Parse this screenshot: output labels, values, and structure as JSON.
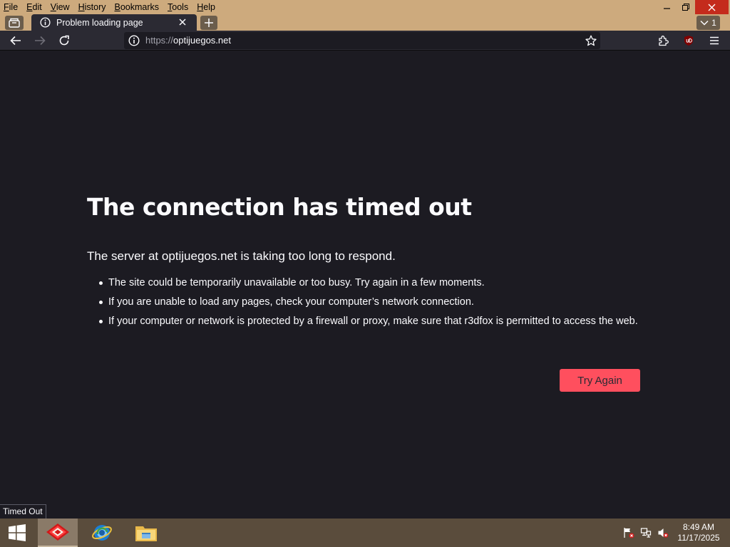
{
  "menu": [
    "File",
    "Edit",
    "View",
    "History",
    "Bookmarks",
    "Tools",
    "Help"
  ],
  "tab": {
    "title": "Problem loading page",
    "list_count": "1"
  },
  "navbar": {
    "url_scheme": "https://",
    "url_host": "optijuegos.net"
  },
  "error": {
    "title": "The connection has timed out",
    "description": "The server at optijuegos.net is taking too long to respond.",
    "items": [
      "The site could be temporarily unavailable or too busy. Try again in a few moments.",
      "If you are unable to load any pages, check your computer’s network connection.",
      "If your computer or network is protected by a firewall or proxy, make sure that r3dfox is permitted to access the web."
    ],
    "button_label": "Try Again"
  },
  "status_text": "Timed Out",
  "clock": {
    "time": "8:49 AM",
    "date": "11/17/2025"
  },
  "colors": {
    "titlebar": "#cdaa7d",
    "toolbar": "#2b2a33",
    "page_bg": "#1c1b22",
    "primary_button": "#ff4f5e",
    "close_button": "#c42b1c",
    "taskbar": "#5a4c3c"
  },
  "icons": [
    "tab-manager-icon",
    "info-icon",
    "close-icon",
    "plus-icon",
    "chevron-down-icon",
    "back-arrow-icon",
    "forward-arrow-icon",
    "reload-icon",
    "star-icon",
    "extensions-icon",
    "ublock-icon",
    "hamburger-menu-icon",
    "windows-start-icon",
    "firefox-icon",
    "ie-icon",
    "folder-icon"
  ]
}
